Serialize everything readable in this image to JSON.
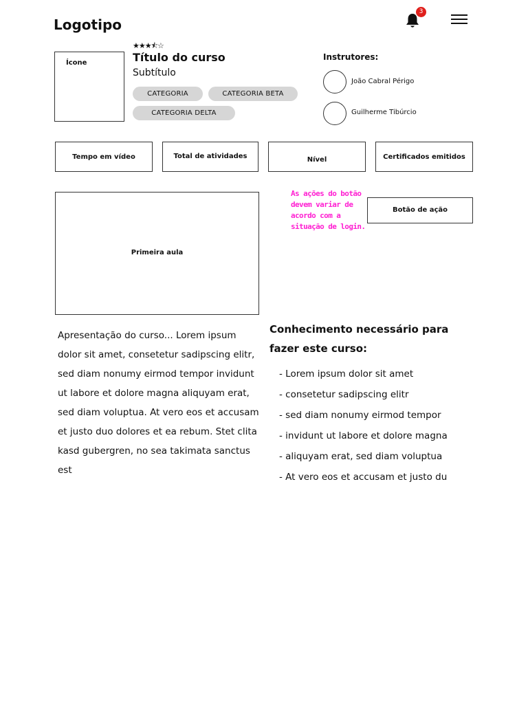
{
  "header": {
    "logo": "Logotipo",
    "notifications": {
      "count": "3",
      "icon": "bell-icon"
    },
    "menu_icon": "hamburger-menu-icon"
  },
  "course": {
    "icon_label": "Ícone",
    "rating": "★★★⯪☆",
    "rating_value": 3.5,
    "title": "Título do curso",
    "subtitle": "Subtítulo",
    "categories": [
      "CATEGORIA",
      "CATEGORIA BETA",
      "CATEGORIA DELTA"
    ]
  },
  "instructors": {
    "label": "Instrutores:",
    "items": [
      {
        "name": "João Cabral Périgo"
      },
      {
        "name": "Guilherme Tibúrcio"
      }
    ]
  },
  "stats": [
    "Tempo em vídeo",
    "Total de atividades",
    "Nível",
    "Certificados emitidos"
  ],
  "video": {
    "label": "Primeira aula"
  },
  "note": "As ações do botão devem variar de acordo com a situação de login.",
  "action_button": {
    "label": "Botão de ação"
  },
  "description": "Apresentação do curso... Lorem ipsum dolor sit amet, consetetur sadipscing elitr, sed diam nonumy eirmod tempor invidunt ut labore et dolore magna aliquyam erat, sed diam voluptua. At vero eos et accusam et justo duo dolores et ea rebum. Stet clita kasd gubergren, no sea takimata sanctus est",
  "requirements": {
    "title": "Conhecimento necessário para fazer este curso:",
    "items": [
      "- Lorem ipsum dolor sit amet",
      "- consetetur sadipscing elitr",
      "- sed diam nonumy eirmod tempor",
      "- invidunt ut labore et dolore magna",
      "- aliquyam erat, sed diam voluptua",
      "- At vero eos et accusam et justo du"
    ]
  },
  "colors": {
    "note": "#ff1fd2",
    "badge": "#e0201c",
    "pill": "#d6d6d6"
  }
}
